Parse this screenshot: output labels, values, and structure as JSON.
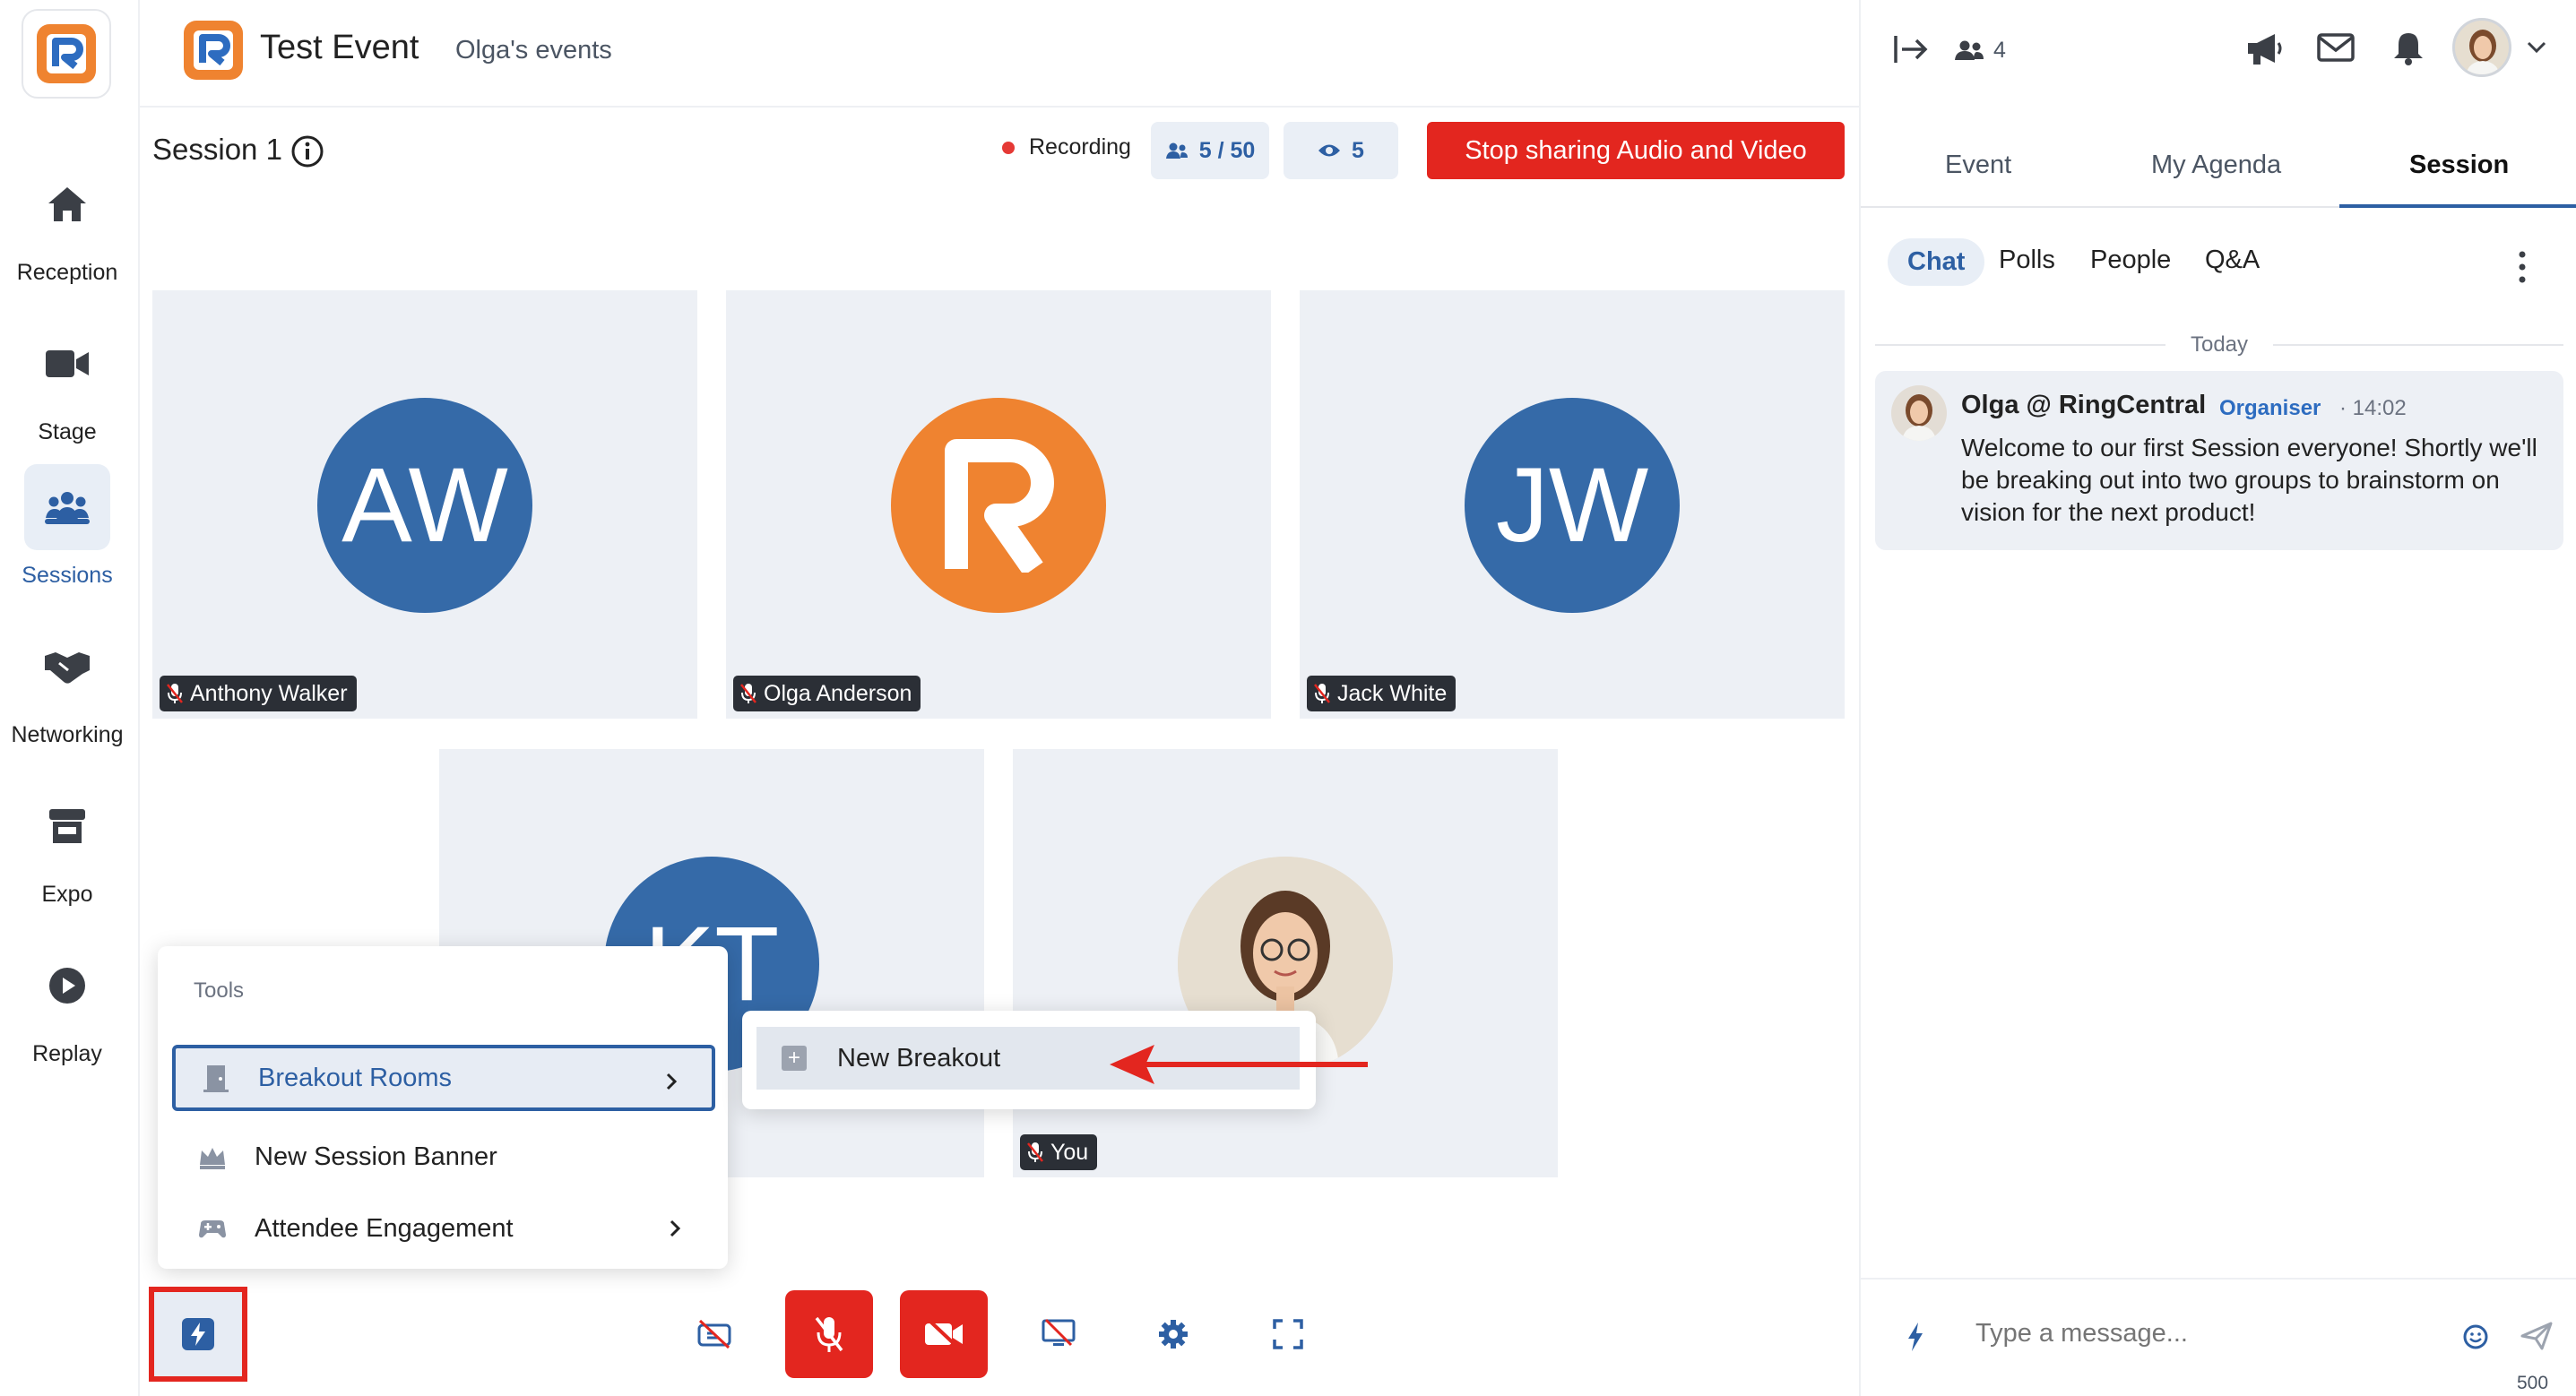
{
  "nav": {
    "items": [
      {
        "label": "Reception",
        "icon": "home-icon"
      },
      {
        "label": "Stage",
        "icon": "video-camera-icon"
      },
      {
        "label": "Sessions",
        "icon": "group-icon"
      },
      {
        "label": "Networking",
        "icon": "handshake-icon"
      },
      {
        "label": "Expo",
        "icon": "store-icon"
      },
      {
        "label": "Replay",
        "icon": "play-circle-icon"
      }
    ],
    "active": "Sessions"
  },
  "header": {
    "event_title": "Test Event",
    "event_owner": "Olga's events"
  },
  "session": {
    "title": "Session 1",
    "recording_label": "Recording",
    "attendees": "5 / 50",
    "viewers": "5",
    "stop_button": "Stop sharing Audio and Video"
  },
  "tiles": [
    {
      "name": "Anthony Walker",
      "initials": "AW",
      "color": "#356aa8"
    },
    {
      "name": "Olga Anderson",
      "initials": "",
      "color": "#ef8330"
    },
    {
      "name": "Jack White",
      "initials": "JW",
      "color": "#356aa8"
    },
    {
      "name": "",
      "initials": "KT",
      "color": "#356aa8"
    },
    {
      "name": "You",
      "initials": "",
      "color": "#e8e2d6"
    }
  ],
  "tools": {
    "heading": "Tools",
    "items": [
      {
        "label": "Breakout Rooms",
        "icon": "door-icon",
        "has_submenu": true
      },
      {
        "label": "New Session Banner",
        "icon": "crown-icon",
        "has_submenu": false
      },
      {
        "label": "Attendee Engagement",
        "icon": "gamepad-icon",
        "has_submenu": true
      }
    ],
    "submenu": {
      "label": "New Breakout"
    }
  },
  "right_panel": {
    "attendee_count": "4",
    "tabs": [
      "Event",
      "My Agenda",
      "Session"
    ],
    "active_tab": "Session",
    "subtabs": [
      "Chat",
      "Polls",
      "People",
      "Q&A"
    ],
    "active_subtab": "Chat",
    "date_divider": "Today",
    "messages": [
      {
        "author": "Olga @ RingCentral",
        "role": "Organiser",
        "time": "· 14:02",
        "text": "Welcome to our first Session everyone! Shortly we'll be breaking out into two groups to brainstorm on vision for the next product!"
      }
    ],
    "composer_placeholder": "Type a message...",
    "char_limit": "500"
  },
  "colors": {
    "brand_blue": "#2d5fa3",
    "brand_orange": "#ef8330",
    "danger_red": "#e3261f"
  }
}
